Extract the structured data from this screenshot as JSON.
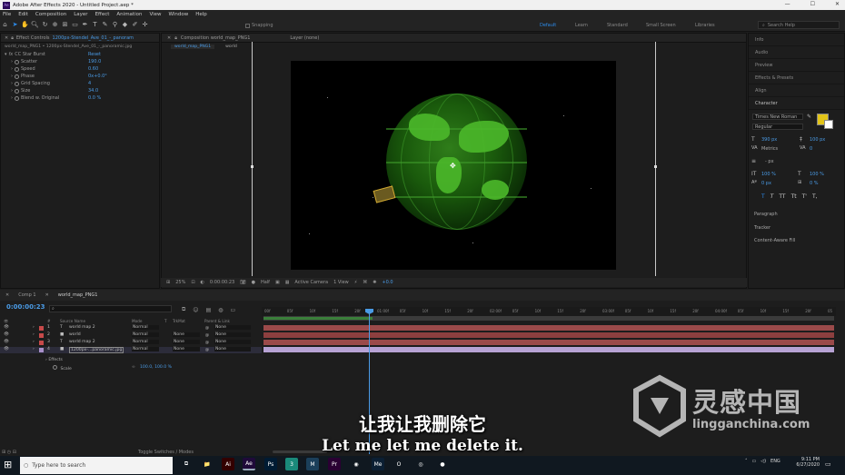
{
  "window": {
    "title": "Adobe After Effects 2020 - Untitled Project.aep *",
    "app_icon": "Ae"
  },
  "menu": [
    "File",
    "Edit",
    "Composition",
    "Layer",
    "Effect",
    "Animation",
    "View",
    "Window",
    "Help"
  ],
  "toolbar": {
    "snapping_label": "Snapping",
    "workspaces": [
      "Default",
      "Learn",
      "Standard",
      "Small Screen",
      "Libraries"
    ],
    "active_workspace": "Default",
    "search_placeholder": "Search Help"
  },
  "effect_controls": {
    "tab_label": "Effect Controls",
    "tab_layer": "1200px-Stendel_Ave_01_-_panoram",
    "breadcrumb": "world_map_PNG1 • 1200px-Stendel_Ave_01_-_panoramic.jpg",
    "effect_name": "CC Star Burst",
    "reset_label": "Reset",
    "properties": [
      {
        "name": "Scatter",
        "value": "190.0"
      },
      {
        "name": "Speed",
        "value": "0.60"
      },
      {
        "name": "Phase",
        "value": "0x+0.0°"
      },
      {
        "name": "Grid Spacing",
        "value": "4"
      },
      {
        "name": "Size",
        "value": "34.0"
      },
      {
        "name": "Blend w. Original",
        "value": "0.0 %"
      }
    ]
  },
  "composition": {
    "tab_label": "Composition world_map_PNG1",
    "layer_tab": "Layer (none)",
    "breadcrumbs": [
      "world_map_PNG1",
      "world"
    ],
    "viewer_bar": {
      "zoom": "25%",
      "timecode": "0:00:00:23",
      "resolution": "Half",
      "camera": "Active Camera",
      "views": "1 View",
      "exposure": "+0.0"
    }
  },
  "right_panel": {
    "items": [
      "Info",
      "Audio",
      "Preview",
      "Effects & Presets",
      "Align"
    ],
    "character": {
      "title": "Character",
      "font_name": "Times New Roman",
      "font_style": "Regular",
      "font_size": "390 px",
      "leading": "100 px",
      "kerning": "Metrics",
      "tracking": "0",
      "stroke_width": "- px",
      "vert_scale": "100 %",
      "horiz_scale": "100 %",
      "baseline": "0 px",
      "tsume": "0 %",
      "fill_color": "#e2c418",
      "stroke_color": "#ffffff",
      "style_buttons": [
        "T",
        "T",
        "TT",
        "Tt",
        "T'",
        "T,"
      ]
    },
    "lower_items": [
      "Paragraph",
      "Tracker",
      "Content-Aware Fill"
    ]
  },
  "timeline": {
    "tabs": [
      "Comp 1",
      "world_map_PNG1"
    ],
    "active_tab": "world_map_PNG1",
    "timecode": "0:00:00:23",
    "search_placeholder": "",
    "columns": {
      "num": "#",
      "source_name": "Source Name",
      "mode": "Mode",
      "t": "T",
      "trkmat": "TrkMat",
      "parent": "Parent & Link"
    },
    "layers": [
      {
        "num": "1",
        "type": "T",
        "name": "world map 2",
        "mode": "Normal",
        "trkmat": "",
        "parent": "None",
        "label_color": "#c74a4a",
        "bar_color": "#9b4a4a"
      },
      {
        "num": "2",
        "type": "■",
        "name": "world",
        "mode": "Normal",
        "trkmat": "None",
        "parent": "None",
        "label_color": "#c74a4a",
        "bar_color": "#8d3f3f"
      },
      {
        "num": "3",
        "type": "T",
        "name": "world map 2",
        "mode": "Normal",
        "trkmat": "None",
        "parent": "None",
        "label_color": "#c74a4a",
        "bar_color": "#9b4a4a"
      },
      {
        "num": "4",
        "type": "■",
        "name": "1200px-...panoramic.jpg",
        "mode": "Normal",
        "trkmat": "None",
        "parent": "None",
        "label_color": "#a88fc9",
        "bar_color": "#b7a2d4"
      }
    ],
    "effects_label": "Effects",
    "scale_label": "Scale",
    "scale_value": "100.0, 100.0 %",
    "ruler_ticks": [
      "00f",
      "05f",
      "10f",
      "15f",
      "20f",
      "01:00f",
      "05f",
      "10f",
      "15f",
      "20f",
      "02:00f",
      "05f",
      "10f",
      "15f",
      "20f",
      "03:00f",
      "05f",
      "10f",
      "15f",
      "20f",
      "04:00f",
      "05f",
      "10f",
      "15f",
      "20f",
      "05"
    ],
    "toggle_label": "Toggle Switches / Modes"
  },
  "subtitles": {
    "chinese": "让我让我删除它",
    "english": "Let me let me delete it."
  },
  "watermark": {
    "cn": "灵感中国",
    "en": "lingganchina.com"
  },
  "taskbar": {
    "search_placeholder": "Type here to search",
    "apps": [
      {
        "name": "task-view",
        "label": "⧉",
        "color": "#101820"
      },
      {
        "name": "file-explorer",
        "label": "📁",
        "color": "#101820"
      },
      {
        "name": "illustrator",
        "label": "Ai",
        "color": "#330000"
      },
      {
        "name": "after-effects",
        "label": "Ae",
        "color": "#1f0a3a"
      },
      {
        "name": "photoshop",
        "label": "Ps",
        "color": "#001b33"
      },
      {
        "name": "app-3",
        "label": "3",
        "color": "#1a8a7a"
      },
      {
        "name": "app-m",
        "label": "M",
        "color": "#1b3f5a"
      },
      {
        "name": "premiere",
        "label": "Pr",
        "color": "#2a0033"
      },
      {
        "name": "app-circle",
        "label": "◉",
        "color": "#101820"
      },
      {
        "name": "media-encoder",
        "label": "Me",
        "color": "#0b1f33"
      },
      {
        "name": "opera",
        "label": "O",
        "color": "#101820"
      },
      {
        "name": "chrome",
        "label": "◎",
        "color": "#101820"
      },
      {
        "name": "app-red",
        "label": "●",
        "color": "#101820"
      }
    ],
    "language": "ENG",
    "time": "9:11 PM",
    "date": "6/27/2020"
  }
}
